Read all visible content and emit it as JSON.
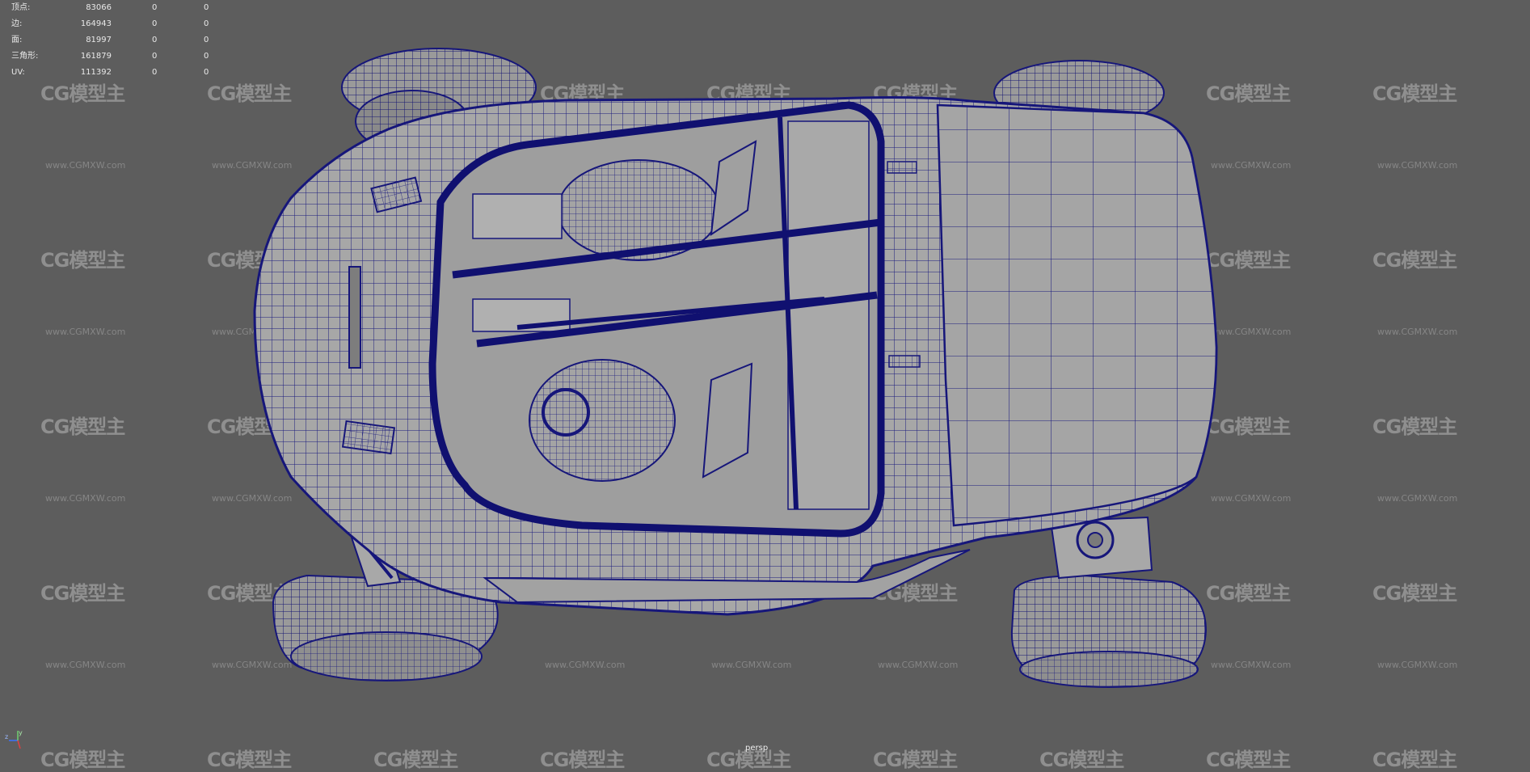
{
  "stats": {
    "rows": [
      {
        "label": "顶点:",
        "value": "83066",
        "sel": "0",
        "tri": "0"
      },
      {
        "label": "边:",
        "value": "164943",
        "sel": "0",
        "tri": "0"
      },
      {
        "label": "面:",
        "value": "81997",
        "sel": "0",
        "tri": "0"
      },
      {
        "label": "三角形:",
        "value": "161879",
        "sel": "0",
        "tri": "0"
      },
      {
        "label": "UV:",
        "value": "111392",
        "sel": "0",
        "tri": "0"
      }
    ]
  },
  "viewport": {
    "camera": "persp",
    "background": "#5d5d5d",
    "wire_color": "#1a1a7a"
  },
  "watermark": {
    "logo": "CG模型主",
    "url": "www.CGMXW.com"
  },
  "axis_gizmo": {
    "z": "z",
    "y": "y"
  }
}
